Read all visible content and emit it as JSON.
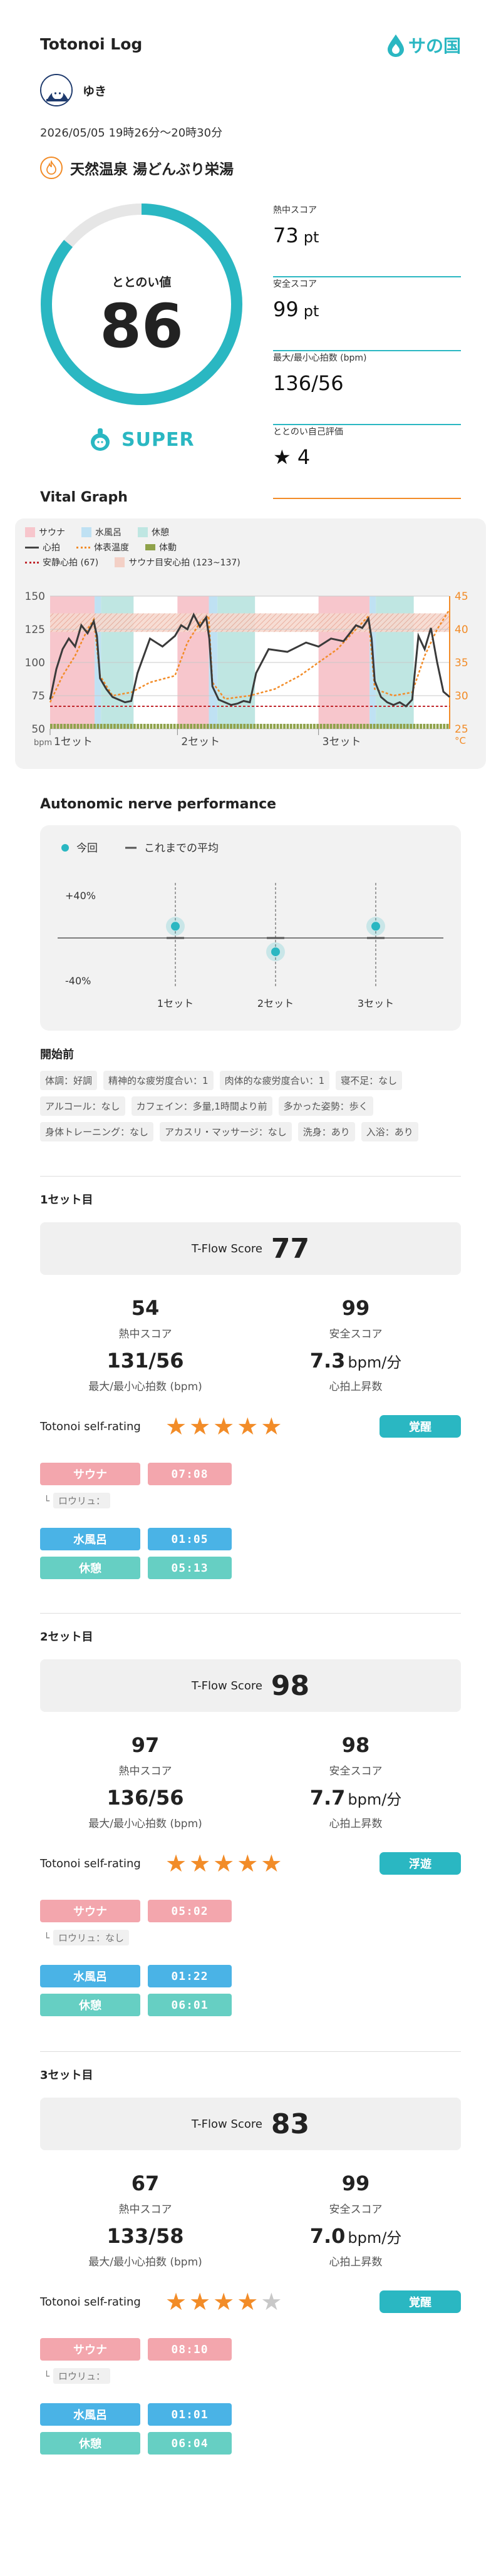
{
  "header": {
    "title": "Totonoi Log",
    "logo_text": "サの国"
  },
  "user": {
    "name": "ゆき"
  },
  "session": {
    "datetime": "2026/05/05 19時26分～20時30分",
    "facility": "天然温泉 湯どんぶり栄湯"
  },
  "gauge": {
    "label": "ととのい値",
    "value": "86",
    "fraction": 0.86,
    "rank": "SUPER"
  },
  "scores": [
    {
      "label": "熱中スコア",
      "value": "73",
      "unit": "pt"
    },
    {
      "label": "安全スコア",
      "value": "99",
      "unit": "pt"
    },
    {
      "label": "最大/最小心拍数 (bpm)",
      "value": "136/56",
      "unit": ""
    },
    {
      "label": "ととのい自己評価",
      "value": "4",
      "unit": "",
      "icon": "star-icon"
    }
  ],
  "vital_graph": {
    "title": "Vital Graph",
    "legend": {
      "sauna": "サウナ",
      "bath": "水風呂",
      "rest": "休憩",
      "heart": "心拍",
      "temp": "体表温度",
      "motion": "体動",
      "safe_hr": "安静心拍 (67)",
      "safe_zone": "サウナ目安心拍 (123~137)"
    },
    "y_left_ticks": [
      "150",
      "125",
      "100",
      "75",
      "50"
    ],
    "y_left_unit": "bpm",
    "y_right_ticks": [
      "45",
      "40",
      "35",
      "30",
      "25"
    ],
    "y_right_unit": "°C",
    "x_labels": [
      "1セット",
      "2セット",
      "3セット"
    ],
    "colors": {
      "sauna": "#f7c6cc",
      "bath": "#bfe1f3",
      "rest": "#bfe6e2",
      "heart": "#3a3a3a",
      "temp": "#f28c28",
      "motion": "#8fa24a",
      "safe_hr": "#c0272d"
    }
  },
  "chart_data": [
    {
      "type": "line",
      "title": "Vital Graph",
      "xlabel": "",
      "ylabel": "bpm",
      "y2label": "°C",
      "ylim": [
        50,
        150
      ],
      "y2lim": [
        25,
        45
      ],
      "phases": [
        {
          "name": "サウナ",
          "start": 0,
          "end": 7.13
        },
        {
          "name": "水風呂",
          "start": 7.13,
          "end": 8.15
        },
        {
          "name": "休憩",
          "start": 8.15,
          "end": 13.37
        },
        {
          "name": "サウナ",
          "start": 20.4,
          "end": 25.43
        },
        {
          "name": "水風呂",
          "start": 25.43,
          "end": 26.8
        },
        {
          "name": "休憩",
          "start": 26.8,
          "end": 32.82
        },
        {
          "name": "サウナ",
          "start": 43,
          "end": 51.17
        },
        {
          "name": "水風呂",
          "start": 51.17,
          "end": 52.18
        },
        {
          "name": "休憩",
          "start": 52.18,
          "end": 58.25
        }
      ],
      "series": [
        {
          "name": "心拍",
          "x": [
            0,
            1,
            2,
            3,
            4,
            5,
            6,
            7,
            7.5,
            8,
            9,
            10,
            11,
            12,
            13,
            14,
            16,
            18,
            20,
            21,
            22,
            23,
            24,
            25,
            25.5,
            26,
            27,
            28,
            29,
            30,
            31,
            32,
            33,
            35,
            38,
            41,
            43,
            45,
            47,
            49,
            50,
            51,
            51.5,
            52,
            53,
            54,
            55,
            56,
            57,
            58,
            59,
            60,
            61,
            62,
            63,
            64
          ],
          "values": [
            72,
            95,
            110,
            118,
            112,
            128,
            122,
            131,
            120,
            88,
            80,
            74,
            72,
            70,
            71,
            92,
            118,
            112,
            120,
            128,
            125,
            136,
            127,
            134,
            118,
            82,
            72,
            70,
            68,
            69,
            71,
            70,
            92,
            110,
            108,
            115,
            112,
            118,
            116,
            128,
            126,
            133,
            118,
            86,
            74,
            70,
            68,
            70,
            67,
            72,
            120,
            110,
            126,
            100,
            78,
            74
          ]
        },
        {
          "name": "体表温度",
          "x": [
            0,
            2,
            4,
            6,
            7,
            8,
            10,
            13,
            16,
            20,
            22,
            24,
            25.4,
            26,
            28,
            32,
            36,
            40,
            43,
            46,
            49,
            51,
            52,
            55,
            58,
            60,
            62,
            64
          ],
          "values": [
            29,
            33,
            36,
            40,
            41.5,
            33,
            30,
            30.5,
            32,
            33,
            38,
            41,
            42,
            32,
            29.5,
            30,
            31,
            33,
            35,
            37,
            40,
            42,
            31,
            30,
            30.5,
            36,
            40,
            43
          ]
        }
      ],
      "reference_lines": {
        "安静心拍": 67,
        "サウナ目安心拍": [
          123,
          137
        ]
      }
    },
    {
      "type": "scatter",
      "title": "Autonomic nerve performance",
      "categories": [
        "1セット",
        "2セット",
        "3セット"
      ],
      "ylim": [
        -40,
        40
      ],
      "series": [
        {
          "name": "今回",
          "values": [
            11,
            -13,
            11
          ]
        },
        {
          "name": "これまでの平均",
          "values": [
            0,
            0,
            0
          ]
        }
      ]
    }
  ],
  "autonomic": {
    "title": "Autonomic nerve performance",
    "legend_current": "今回",
    "legend_average": "これまでの平均",
    "y_top": "+40%",
    "y_bottom": "-40%",
    "sets": [
      "1セット",
      "2セット",
      "3セット"
    ]
  },
  "pre_start": {
    "title": "開始前",
    "tags": [
      "体調：好調",
      "精神的な疲労度合い：1",
      "肉体的な疲労度合い：1",
      "寝不足：なし",
      "アルコール：なし",
      "カフェイン：多量,1時間より前",
      "多かった姿勢：歩く",
      "身体トレーニング：なし",
      "アカスリ・マッサージ：なし",
      "洗身：あり",
      "入浴：あり"
    ]
  },
  "sets": [
    {
      "title": "1セット目",
      "tflow_label": "T-Flow Score",
      "tflow": "77",
      "heat": "54",
      "heat_label": "熱中スコア",
      "safety": "99",
      "safety_label": "安全スコア",
      "hr": "131/56",
      "hr_label": "最大/最小心拍数 (bpm)",
      "rise": "7.3",
      "rise_unit": "bpm/分",
      "rise_label": "心拍上昇数",
      "rating_label": "Totonoi self-rating",
      "stars": 5,
      "status": "覚醒",
      "sauna_label": "サウナ",
      "sauna_time": "07:08",
      "loyly_label": "ロウリュ：",
      "loyly_value": "",
      "bath_label": "水風呂",
      "bath_time": "01:05",
      "rest_label": "休憩",
      "rest_time": "05:13"
    },
    {
      "title": "2セット目",
      "tflow_label": "T-Flow Score",
      "tflow": "98",
      "heat": "97",
      "heat_label": "熱中スコア",
      "safety": "98",
      "safety_label": "安全スコア",
      "hr": "136/56",
      "hr_label": "最大/最小心拍数 (bpm)",
      "rise": "7.7",
      "rise_unit": "bpm/分",
      "rise_label": "心拍上昇数",
      "rating_label": "Totonoi self-rating",
      "stars": 5,
      "status": "浮遊",
      "sauna_label": "サウナ",
      "sauna_time": "05:02",
      "loyly_label": "ロウリュ：",
      "loyly_value": "なし",
      "bath_label": "水風呂",
      "bath_time": "01:22",
      "rest_label": "休憩",
      "rest_time": "06:01"
    },
    {
      "title": "3セット目",
      "tflow_label": "T-Flow Score",
      "tflow": "83",
      "heat": "67",
      "heat_label": "熱中スコア",
      "safety": "99",
      "safety_label": "安全スコア",
      "hr": "133/58",
      "hr_label": "最大/最小心拍数 (bpm)",
      "rise": "7.0",
      "rise_unit": "bpm/分",
      "rise_label": "心拍上昇数",
      "rating_label": "Totonoi self-rating",
      "stars": 4,
      "status": "覚醒",
      "sauna_label": "サウナ",
      "sauna_time": "08:10",
      "loyly_label": "ロウリュ：",
      "loyly_value": "",
      "bath_label": "水風呂",
      "bath_time": "01:01",
      "rest_label": "休憩",
      "rest_time": "06:04"
    }
  ]
}
